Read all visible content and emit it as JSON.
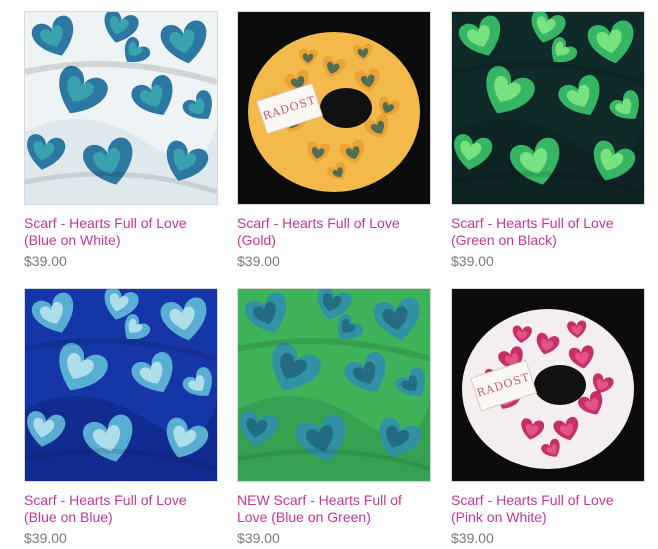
{
  "products": [
    {
      "title": "Scarf - Hearts Full of Love (Blue on White)",
      "price": "$39.00",
      "image": "scarf-blue-hearts-on-white",
      "bg": "#eef3f5",
      "heart": "#1c6e9a",
      "heart2": "#3fb0b3",
      "shade": "#cfdde3"
    },
    {
      "title": "Scarf - Hearts Full of Love (Gold)",
      "price": "$39.00",
      "image": "scarf-gold-rolled",
      "bg": "#0b0b0b",
      "heart": "#e9a132",
      "heart2": "#2b5f5b",
      "shade": "#f3b94b",
      "tag": "RADOST"
    },
    {
      "title": "Scarf - Hearts Full of Love (Green on Black)",
      "price": "$39.00",
      "image": "scarf-green-hearts-on-black",
      "bg": "#102a2a",
      "heart": "#39c26a",
      "heart2": "#8ff08a",
      "shade": "#0b1c1d"
    },
    {
      "title": "Scarf - Hearts Full of Love (Blue on Blue)",
      "price": "$39.00",
      "image": "scarf-blue-hearts-on-blue",
      "bg": "#1636a8",
      "heart": "#5fb9d8",
      "heart2": "#c9eef0",
      "shade": "#0c2278"
    },
    {
      "title": "NEW Scarf - Hearts Full of Love (Blue on Green)",
      "price": "$39.00",
      "image": "scarf-blue-hearts-on-green",
      "bg": "#3fb35a",
      "heart": "#2f8fa8",
      "heart2": "#1f5f75",
      "shade": "#2e9247"
    },
    {
      "title": "Scarf - Hearts Full of Love (Pink on White)",
      "price": "$39.00",
      "image": "scarf-pink-rolled",
      "bg": "#0b0b0b",
      "heart": "#c01c58",
      "heart2": "#e85d93",
      "shade": "#f4eef0",
      "tag": "RADOST"
    }
  ]
}
